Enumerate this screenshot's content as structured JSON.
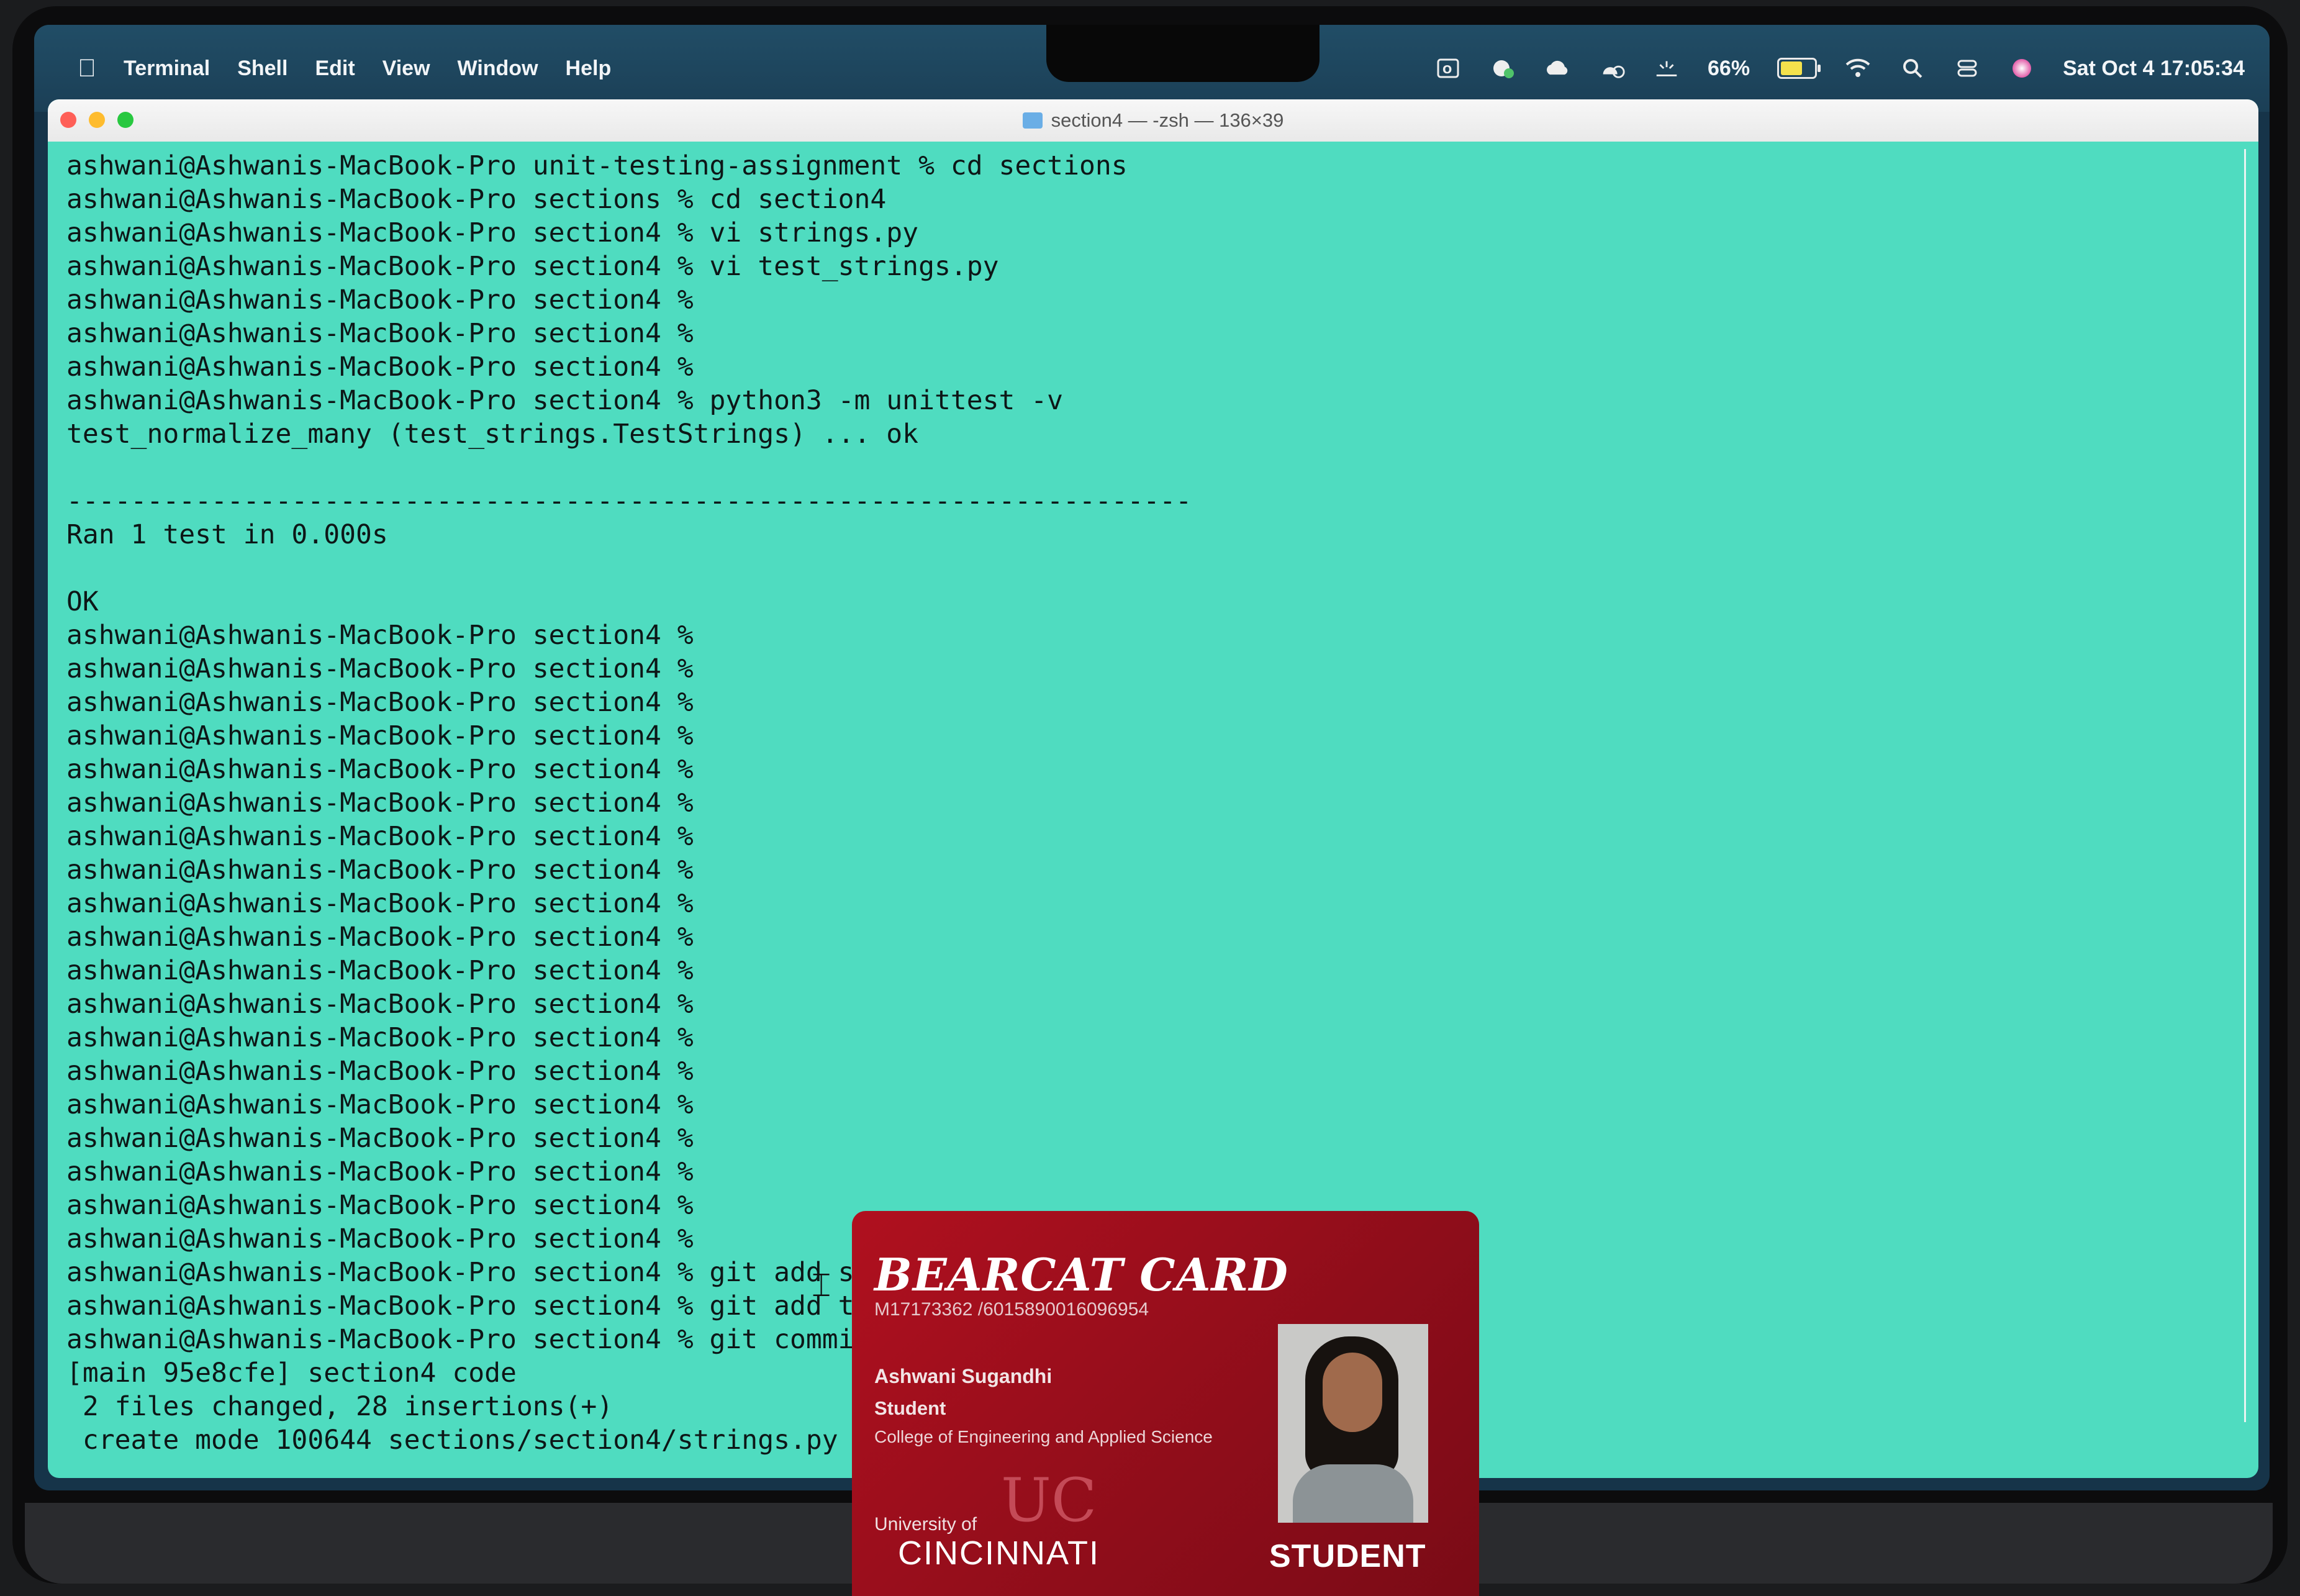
{
  "menubar": {
    "app_name": "Terminal",
    "menus": [
      "Shell",
      "Edit",
      "View",
      "Window",
      "Help"
    ],
    "battery_percent": "66%",
    "battery_level": 0.66,
    "datetime": "Sat Oct 4  17:05:34",
    "status_icons": [
      "outlook-icon",
      "cloud-sync-icon",
      "icloud-icon",
      "backup-icon",
      "brightness-icon",
      "battery-icon",
      "wifi-icon",
      "search-icon",
      "control-center-icon",
      "siri-icon"
    ]
  },
  "window": {
    "title": "section4 — -zsh — 136×39"
  },
  "terminal": {
    "lines": [
      "ashwani@Ashwanis-MacBook-Pro unit-testing-assignment % cd sections",
      "ashwani@Ashwanis-MacBook-Pro sections % cd section4",
      "ashwani@Ashwanis-MacBook-Pro section4 % vi strings.py",
      "ashwani@Ashwanis-MacBook-Pro section4 % vi test_strings.py",
      "ashwani@Ashwanis-MacBook-Pro section4 %",
      "ashwani@Ashwanis-MacBook-Pro section4 %",
      "ashwani@Ashwanis-MacBook-Pro section4 %",
      "ashwani@Ashwanis-MacBook-Pro section4 % python3 -m unittest -v",
      "test_normalize_many (test_strings.TestStrings) ... ok",
      "",
      "----------------------------------------------------------------------",
      "Ran 1 test in 0.000s",
      "",
      "OK",
      "ashwani@Ashwanis-MacBook-Pro section4 %",
      "ashwani@Ashwanis-MacBook-Pro section4 %",
      "ashwani@Ashwanis-MacBook-Pro section4 %",
      "ashwani@Ashwanis-MacBook-Pro section4 %",
      "ashwani@Ashwanis-MacBook-Pro section4 %",
      "ashwani@Ashwanis-MacBook-Pro section4 %",
      "ashwani@Ashwanis-MacBook-Pro section4 %",
      "ashwani@Ashwanis-MacBook-Pro section4 %",
      "ashwani@Ashwanis-MacBook-Pro section4 %",
      "ashwani@Ashwanis-MacBook-Pro section4 %",
      "ashwani@Ashwanis-MacBook-Pro section4 %",
      "ashwani@Ashwanis-MacBook-Pro section4 %",
      "ashwani@Ashwanis-MacBook-Pro section4 %",
      "ashwani@Ashwanis-MacBook-Pro section4 %",
      "ashwani@Ashwanis-MacBook-Pro section4 %",
      "ashwani@Ashwanis-MacBook-Pro section4 %",
      "ashwani@Ashwanis-MacBook-Pro section4 %",
      "ashwani@Ashwanis-MacBook-Pro section4 %",
      "ashwani@Ashwanis-MacBook-Pro section4 %",
      "ashwani@Ashwanis-MacBook-Pro section4 % git add st",
      "ashwani@Ashwanis-MacBook-Pro section4 % git add te",
      "ashwani@Ashwanis-MacBook-Pro section4 % git commit",
      "[main 95e8cfe] section4 code",
      " 2 files changed, 28 insertions(+)",
      " create mode 100644 sections/section4/strings.py"
    ]
  },
  "id_card": {
    "title": "BEARCAT CARD",
    "number": "M17173362 /6015890016096954",
    "name": "Ashwani Sugandhi",
    "role": "Student",
    "college": "College of Engineering and Applied Science",
    "university_prefix": "University of",
    "university_name": "CINCINNATI",
    "badge": "STUDENT"
  },
  "colors": {
    "terminal_bg": "#4fdcc0",
    "terminal_fg": "#0d1717",
    "card_red": "#9e0e1c"
  }
}
